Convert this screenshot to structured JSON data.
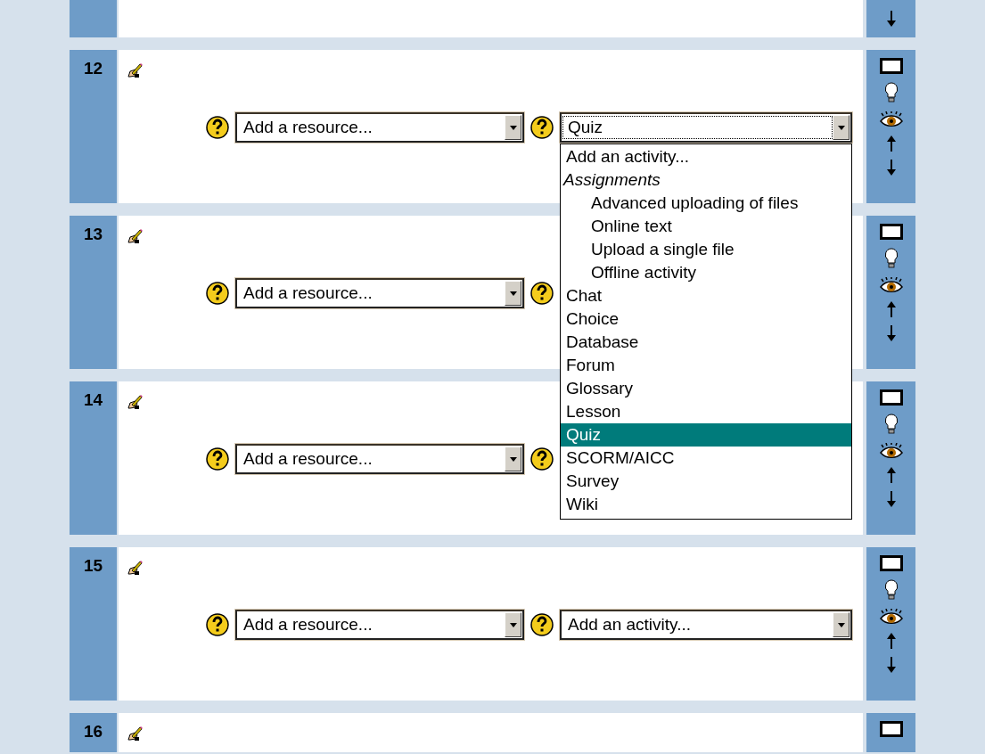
{
  "sections": [
    {
      "number": "12",
      "resource_select": {
        "value": "Add a resource..."
      },
      "activity_select": {
        "value": "Quiz",
        "expanded": true,
        "options": [
          {
            "label": "Add an activity...",
            "kind": "option",
            "selected": false
          },
          {
            "label": "Assignments",
            "kind": "group",
            "children": [
              {
                "label": "Advanced uploading of files",
                "selected": false
              },
              {
                "label": "Online text",
                "selected": false
              },
              {
                "label": "Upload a single file",
                "selected": false
              },
              {
                "label": "Offline activity",
                "selected": false
              }
            ]
          },
          {
            "label": "Chat",
            "kind": "option",
            "selected": false
          },
          {
            "label": "Choice",
            "kind": "option",
            "selected": false
          },
          {
            "label": "Database",
            "kind": "option",
            "selected": false
          },
          {
            "label": "Forum",
            "kind": "option",
            "selected": false
          },
          {
            "label": "Glossary",
            "kind": "option",
            "selected": false
          },
          {
            "label": "Lesson",
            "kind": "option",
            "selected": false
          },
          {
            "label": "Quiz",
            "kind": "option",
            "selected": true
          },
          {
            "label": "SCORM/AICC",
            "kind": "option",
            "selected": false
          },
          {
            "label": "Survey",
            "kind": "option",
            "selected": false
          },
          {
            "label": "Wiki",
            "kind": "option",
            "selected": false
          }
        ]
      }
    },
    {
      "number": "13",
      "resource_select": {
        "value": "Add a resource..."
      }
    },
    {
      "number": "14",
      "resource_select": {
        "value": "Add a resource..."
      }
    },
    {
      "number": "15",
      "resource_select": {
        "value": "Add a resource..."
      },
      "activity_select": {
        "value": "Add an activity...",
        "expanded": false
      }
    },
    {
      "number": "16"
    }
  ]
}
